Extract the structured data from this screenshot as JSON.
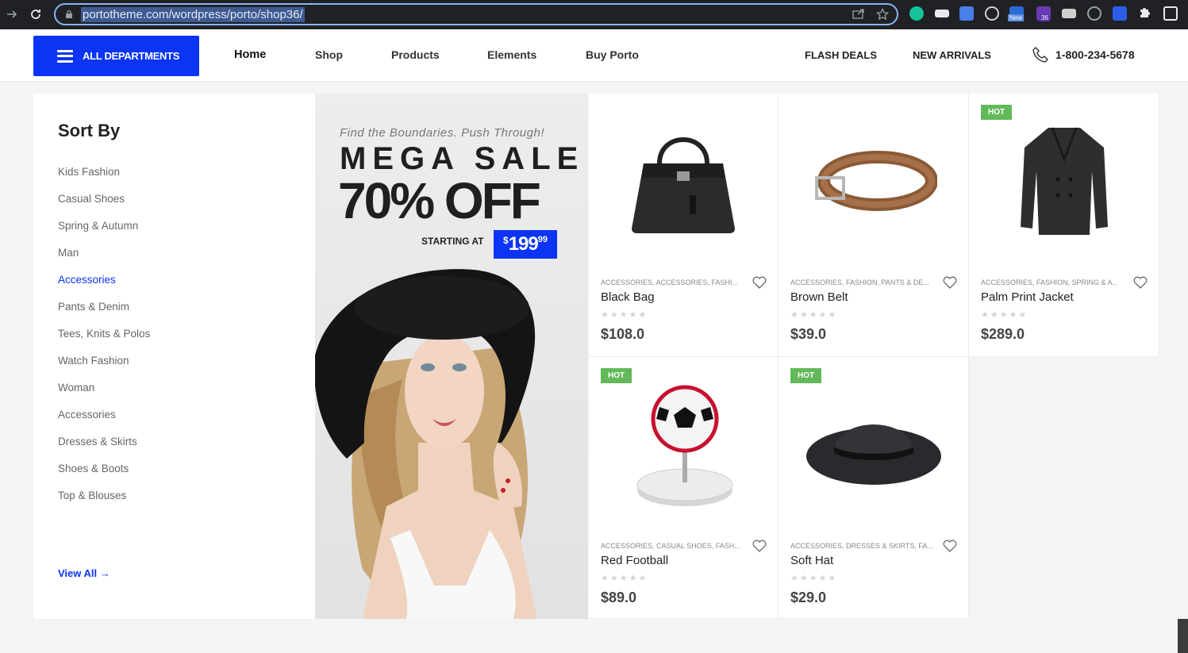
{
  "browser": {
    "url": "portotheme.com/wordpress/porto/shop36/",
    "ext_badge_new": "New",
    "ext_badge_count": "36"
  },
  "header": {
    "all_departments": "ALL DEPARTMENTS",
    "menu": [
      "Home",
      "Shop",
      "Products",
      "Elements",
      "Buy Porto"
    ],
    "flash_deals": "FLASH DEALS",
    "new_arrivals": "NEW ARRIVALS",
    "phone": "1-800-234-5678"
  },
  "sidebar": {
    "title": "Sort By",
    "categories": [
      "Kids Fashion",
      "Casual Shoes",
      "Spring & Autumn",
      "Man",
      "Accessories",
      "Pants & Denim",
      "Tees, Knits & Polos",
      "Watch Fashion",
      "Woman",
      "Accessories",
      "Dresses & Skirts",
      "Shoes & Boots",
      "Top & Blouses"
    ],
    "active_index": 4,
    "view_all": "View All →"
  },
  "banner": {
    "tagline": "Find the Boundaries. Push Through!",
    "headline": "MEGA SALE",
    "discount": "70% OFF",
    "starting_at": "STARTING AT",
    "price_currency": "$",
    "price_main": "199",
    "price_cents": "99"
  },
  "products": [
    {
      "name": "Black Bag",
      "categories": "ACCESSORIES, ACCESSORIES, FASHI...",
      "price": "$108.0",
      "hot": false,
      "hot_label": ""
    },
    {
      "name": "Brown Belt",
      "categories": "ACCESSORIES, FASHION, PANTS & DE...",
      "price": "$39.0",
      "hot": false,
      "hot_label": ""
    },
    {
      "name": "Palm Print Jacket",
      "categories": "ACCESSORIES, FASHION, SPRING & A...",
      "price": "$289.0",
      "hot": true,
      "hot_label": "HOT"
    },
    {
      "name": "Red Football",
      "categories": "ACCESSORIES, CASUAL SHOES, FASH...",
      "price": "$89.0",
      "hot": true,
      "hot_label": "HOT"
    },
    {
      "name": "Soft Hat",
      "categories": "ACCESSORIES, DRESSES & SKIRTS, FA...",
      "price": "$29.0",
      "hot": true,
      "hot_label": "HOT"
    }
  ],
  "colors": {
    "accent": "#0b34f5",
    "hot_badge": "#62b959"
  }
}
